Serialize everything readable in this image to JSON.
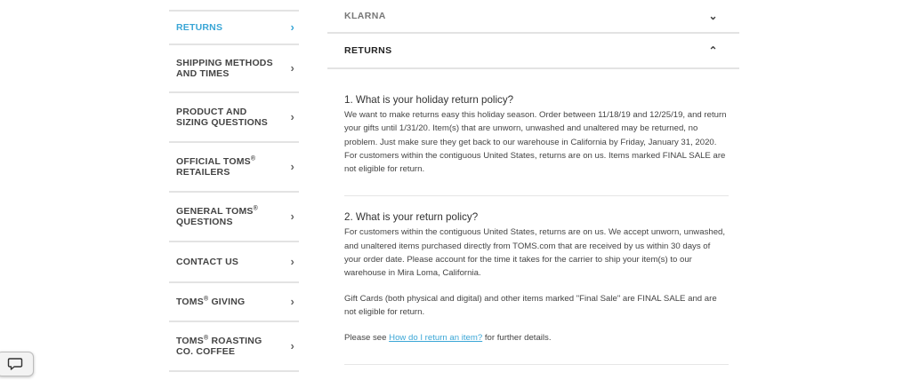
{
  "sidebar": {
    "items": [
      {
        "label": "RETURNS",
        "sup": "",
        "label2": ""
      },
      {
        "label": "SHIPPING METHODS AND TIMES",
        "sup": "",
        "label2": ""
      },
      {
        "label": "PRODUCT AND SIZING QUESTIONS",
        "sup": "",
        "label2": ""
      },
      {
        "label": "OFFICIAL TOMS",
        "sup": "®",
        "label2": "RETAILERS"
      },
      {
        "label": "GENERAL TOMS",
        "sup": "®",
        "label2": "QUESTIONS"
      },
      {
        "label": "CONTACT US",
        "sup": "",
        "label2": ""
      },
      {
        "label": "TOMS",
        "sup": "®",
        "label2": "GIVING"
      },
      {
        "label": "TOMS",
        "sup": "®",
        "label2": "ROASTING CO. COFFEE"
      }
    ],
    "chevron": "›"
  },
  "accordion": {
    "klarna_label": "KLARNA",
    "returns_label": "RETURNS",
    "chevron_down": "⌄",
    "chevron_up": "⌃"
  },
  "qa": [
    {
      "question": "1. What is your holiday return policy?",
      "answer": "We want to make returns easy this holiday season. Order between 11/18/19 and 12/25/19, and return your gifts until 1/31/20. Item(s) that are unworn, unwashed and unaltered may be returned, no problem. Just make sure they get back to our warehouse in California by Friday, January 31, 2020. For customers within the contiguous United States, returns are on us. Items marked FINAL SALE are not eligible for return."
    },
    {
      "question": "2. What is your return policy?",
      "answer": "For customers within the contiguous United States, returns are on us. We accept unworn, unwashed, and unaltered items purchased directly from TOMS.com that are received by us within 30 days of your order date. Please account for the time it takes for the carrier to ship your item(s) to our warehouse in Mira Loma, California.",
      "answer2": "Gift Cards (both physical and digital) and other items marked \"Final Sale\" are FINAL SALE and are not eligible for return.",
      "see_prefix": "Please see ",
      "see_link": "How do I return an item?",
      "see_suffix": " for further details."
    }
  ],
  "colors": {
    "accent": "#3aa6d6",
    "divider": "#e3e3e3"
  },
  "icons": {
    "chat": "chat-bubble-icon"
  }
}
